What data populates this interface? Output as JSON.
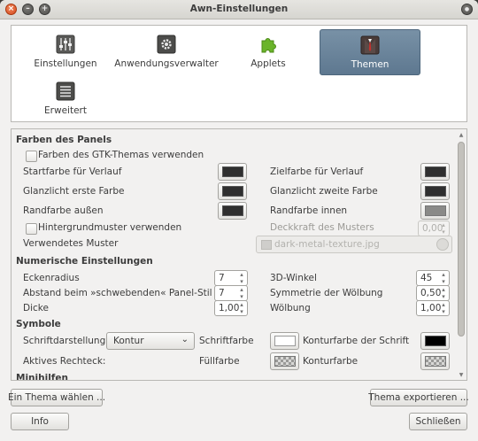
{
  "window": {
    "title": "Awn-Einstellungen",
    "controls": {
      "close": "×",
      "minimize": "–",
      "maximize": "+",
      "extra": "●"
    }
  },
  "categories": [
    {
      "label": "Einstellungen",
      "icon": "sliders-icon",
      "selected": false
    },
    {
      "label": "Anwendungsverwalter",
      "icon": "gear-box-icon",
      "selected": false
    },
    {
      "label": "Applets",
      "icon": "puzzle-icon",
      "selected": false
    },
    {
      "label": "Themen",
      "icon": "suit-icon",
      "selected": true
    },
    {
      "label": "Erweitert",
      "icon": "list-icon",
      "selected": false
    }
  ],
  "colors": {
    "dark_swatch": "#2f2f2f",
    "gray_swatch": "#8a8a88",
    "white_swatch": "#ffffff",
    "black_swatch": "#000000",
    "selection": "#6b8399",
    "applet_green": "#6ab42a"
  },
  "panel": {
    "section_colors": "Farben des Panels",
    "use_gtk_theme": "Farben des GTK-Themas verwenden",
    "start_color": "Startfarbe für Verlauf",
    "target_color": "Zielfarbe für Verlauf",
    "highlight_first": "Glanzlicht erste Farbe",
    "highlight_second": "Glanzlicht zweite Farbe",
    "border_outer": "Randfarbe außen",
    "border_inner": "Randfarbe innen",
    "use_pattern": "Hintergrundmuster verwenden",
    "pattern_opacity": "Deckkraft des Musters",
    "pattern_opacity_value": "0,00",
    "pattern_used": "Verwendetes Muster",
    "pattern_file": "dark-metal-texture.jpg",
    "section_numeric": "Numerische Einstellungen",
    "corner_radius": "Eckenradius",
    "corner_radius_value": "7",
    "angle_3d": "3D-Winkel",
    "angle_3d_value": "45",
    "float_distance": "Abstand beim »schwebenden« Panel-Stil",
    "float_distance_value": "7",
    "curve_symmetry": "Symmetrie der Wölbung",
    "curve_symmetry_value": "0,50",
    "thickness": "Dicke",
    "thickness_value": "1,00",
    "curvature": "Wölbung",
    "curvature_value": "1,00",
    "section_symbols": "Symbole",
    "font_rendering": "Schriftdarstellung",
    "font_rendering_value": "Kontur",
    "font_color": "Schriftfarbe",
    "font_outline_color": "Konturfarbe der Schrift",
    "active_rect": "Aktives Rechteck:",
    "fill_color": "Füllfarbe",
    "outline_color": "Konturfarbe",
    "section_minihelp": "Minihilfen"
  },
  "buttons": {
    "choose_theme": "Ein Thema wählen ...",
    "export_theme": "Thema exportieren ...",
    "info": "Info",
    "close": "Schließen"
  }
}
